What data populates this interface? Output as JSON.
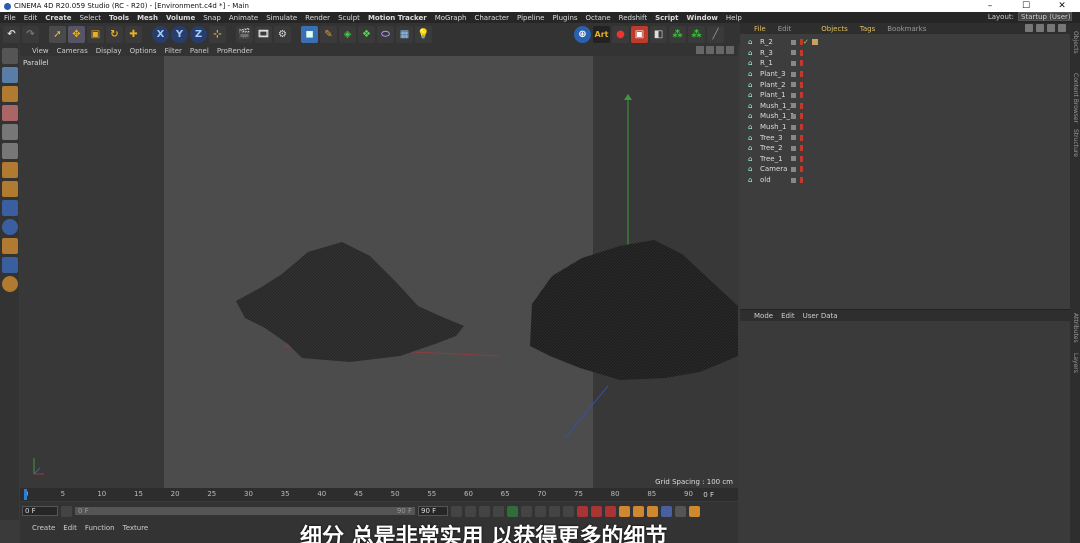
{
  "window": {
    "title": "CINEMA 4D R20.059 Studio (RC - R20) - [Environment.c4d *] - Main",
    "controls": [
      "–",
      "☐",
      "✕"
    ]
  },
  "menu": {
    "items": [
      {
        "label": "File",
        "bold": false
      },
      {
        "label": "Edit",
        "bold": false
      },
      {
        "label": "Create",
        "bold": true
      },
      {
        "label": "Select",
        "bold": false
      },
      {
        "label": "Tools",
        "bold": true
      },
      {
        "label": "Mesh",
        "bold": true
      },
      {
        "label": "Volume",
        "bold": true
      },
      {
        "label": "Snap",
        "bold": false
      },
      {
        "label": "Animate",
        "bold": false
      },
      {
        "label": "Simulate",
        "bold": false
      },
      {
        "label": "Render",
        "bold": false
      },
      {
        "label": "Sculpt",
        "bold": false
      },
      {
        "label": "Motion Tracker",
        "bold": true
      },
      {
        "label": "MoGraph",
        "bold": false
      },
      {
        "label": "Character",
        "bold": false
      },
      {
        "label": "Pipeline",
        "bold": false
      },
      {
        "label": "Plugins",
        "bold": false
      },
      {
        "label": "Octane",
        "bold": false
      },
      {
        "label": "Redshift",
        "bold": false
      },
      {
        "label": "Script",
        "bold": true
      },
      {
        "label": "Window",
        "bold": true
      },
      {
        "label": "Help",
        "bold": false
      }
    ],
    "layout_label": "Layout:",
    "layout_value": "Startup (User)"
  },
  "toolbar": {
    "axis_labels": [
      "X",
      "Y",
      "Z"
    ],
    "art_label": "Art"
  },
  "viewport": {
    "menu": [
      "View",
      "Cameras",
      "Display",
      "Options",
      "Filter",
      "Panel",
      "ProRender"
    ],
    "projection": "Parallel",
    "grid_spacing": "Grid Spacing : 100 cm"
  },
  "timeline": {
    "ticks": [
      "0",
      "5",
      "10",
      "15",
      "20",
      "25",
      "30",
      "35",
      "40",
      "45",
      "50",
      "55",
      "60",
      "65",
      "70",
      "75",
      "80",
      "85",
      "90"
    ],
    "current_frame": "0 F",
    "frame_end_label": "0 F",
    "start_field": "0 F",
    "slider_start": "0 F",
    "slider_end": "90 F",
    "end_field": "90 F"
  },
  "bottom_menu": [
    "Create",
    "Edit",
    "Function",
    "Texture"
  ],
  "objects_panel": {
    "tabs": [
      "File",
      "Edit",
      "Objects",
      "Tags",
      "Bookmarks"
    ],
    "rows": [
      {
        "name": "R_2",
        "check": "✓",
        "has_tag": true
      },
      {
        "name": "R_3",
        "check": "",
        "has_tag": false
      },
      {
        "name": "R_1",
        "check": "",
        "has_tag": false
      },
      {
        "name": "Plant_3",
        "check": "",
        "has_tag": false
      },
      {
        "name": "Plant_2",
        "check": "",
        "has_tag": false
      },
      {
        "name": "Plant_1",
        "check": "",
        "has_tag": false
      },
      {
        "name": "Mush_1_2",
        "check": "",
        "has_tag": false
      },
      {
        "name": "Mush_1_1",
        "check": "",
        "has_tag": false
      },
      {
        "name": "Mush_1",
        "check": "",
        "has_tag": false
      },
      {
        "name": "Tree_3",
        "check": "",
        "has_tag": false
      },
      {
        "name": "Tree_2",
        "check": "",
        "has_tag": false
      },
      {
        "name": "Tree_1",
        "check": "",
        "has_tag": false
      },
      {
        "name": "Camera",
        "check": "",
        "has_tag": false
      },
      {
        "name": "old",
        "check": "",
        "has_tag": false
      }
    ]
  },
  "attributes_panel": {
    "tabs": [
      "Mode",
      "Edit",
      "User Data"
    ]
  },
  "right_strip": [
    "Objects",
    "Content Browser",
    "Structure",
    "Attributes",
    "Layers"
  ],
  "subtitle": "细分 总是非常实用 以获得更多的细节"
}
